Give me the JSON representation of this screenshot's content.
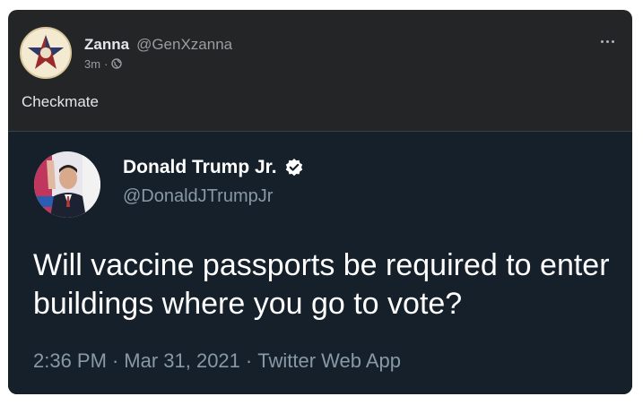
{
  "post": {
    "author_name": "Zanna",
    "author_handle": "@GenXzanna",
    "time": "3m",
    "separator": "·",
    "audience_icon": "public-globe-icon",
    "more_icon": "more-options-icon",
    "text": "Checkmate",
    "avatar_icon": "star-emblem-icon"
  },
  "tweet": {
    "author_name": "Donald Trump Jr.",
    "author_handle": "@DonaldJTrumpJr",
    "verified_icon": "verified-badge-icon",
    "text": "Will vaccine passports be required to enter buildings where you go to vote?",
    "time": "2:36 PM",
    "separator": "·",
    "date": "Mar 31, 2021",
    "source": "Twitter Web App"
  },
  "colors": {
    "post_background": "#242526",
    "tweet_background": "#15202b",
    "verified_blue": "#ffffff"
  }
}
